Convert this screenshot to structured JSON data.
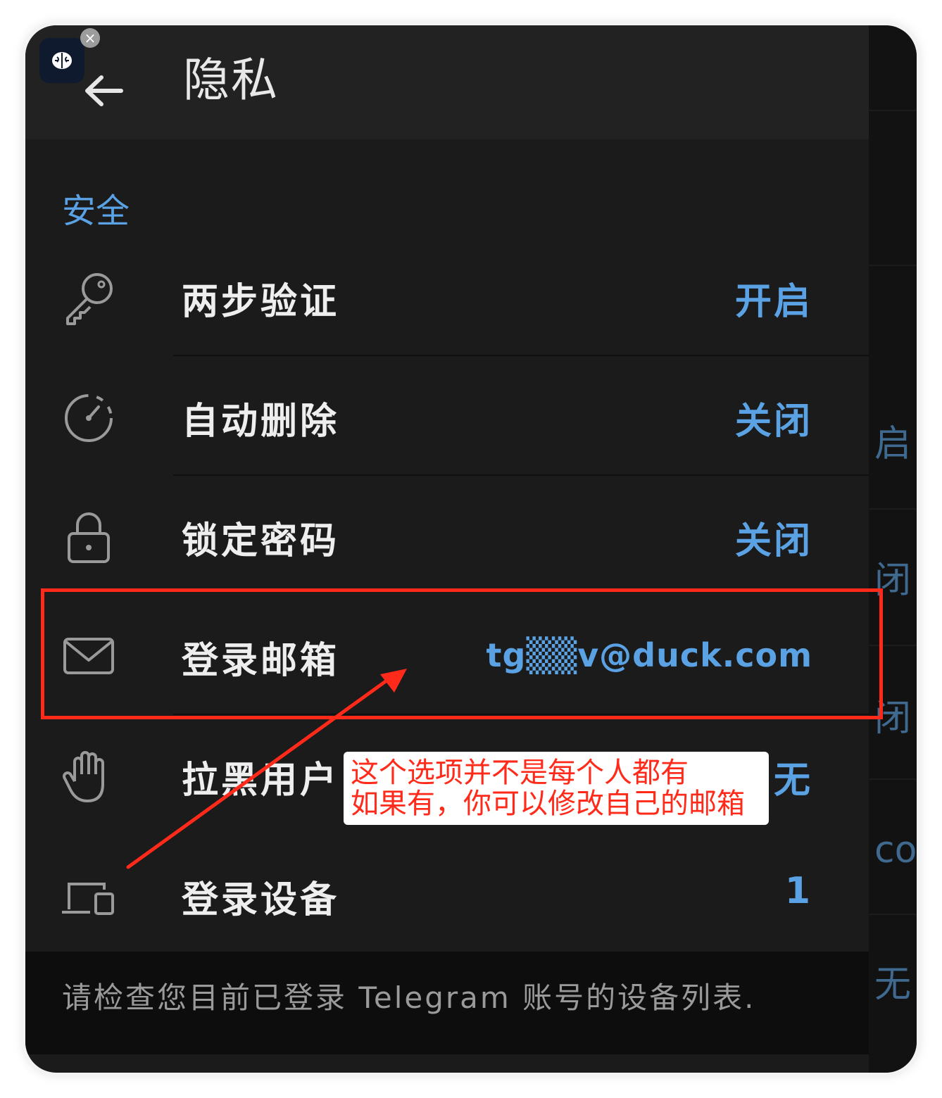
{
  "header": {
    "title": "隐私",
    "back_icon": "arrow-left-icon"
  },
  "section": {
    "title": "安全"
  },
  "rows": [
    {
      "label": "两步验证",
      "value": "开启",
      "icon": "key-icon"
    },
    {
      "label": "自动删除",
      "value": "关闭",
      "icon": "timer-icon"
    },
    {
      "label": "锁定密码",
      "value": "关闭",
      "icon": "lock-icon"
    },
    {
      "label": "登录邮箱",
      "value": "tg▒▒v@duck.com",
      "icon": "mail-icon"
    },
    {
      "label": "拉黑用户",
      "value": "无",
      "icon": "hand-icon"
    },
    {
      "label": "登录设备",
      "value": "1",
      "icon": "devices-icon"
    }
  ],
  "footer": {
    "text": "请检查您目前已登录 Telegram 账号的设备列表."
  },
  "annotation": {
    "line1": "这个选项并不是每个人都有",
    "line2": "如果有，你可以修改自己的邮箱"
  },
  "background_strip": {
    "items": [
      "启",
      "闭",
      "闭",
      "com",
      "无"
    ]
  },
  "colors": {
    "accent": "#5aa2e4",
    "background": "#1b1b1b",
    "annotation_red": "#ff2a1a"
  }
}
